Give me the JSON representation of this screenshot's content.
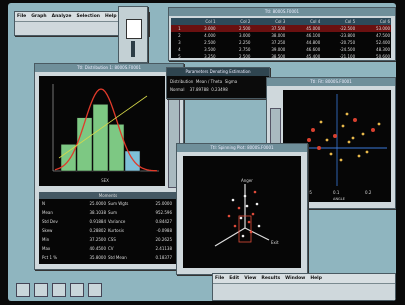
{
  "app": {
    "main_menu": [
      "File",
      "Graph",
      "Analyze",
      "Selection",
      "Help"
    ],
    "bottom_menu": [
      "File",
      "Edit",
      "View",
      "Results",
      "Window",
      "Help"
    ]
  },
  "windows": {
    "table_title": "Ttl: 8000S.F0001",
    "histogram_title": "Ttl: Distribution 1: 8000S.F0001",
    "params_title": "Parameters Denoting Estimation",
    "params_row1": [
      "Distribution",
      "Mean / Theta",
      "Sigma"
    ],
    "params_row2": [
      "Normal",
      "37.89788",
      "0.23498"
    ],
    "scatter_title": "Ttl: Fit: 8000S.F0001",
    "spin_title": "Ttl: Spinning Plot: 8000S.F0001",
    "stats_title": "Moments",
    "scatter_labels": [
      "0.05",
      "0.1",
      "0.2"
    ],
    "scatter_xlabel": "ANGLE",
    "spin_labels": [
      "Anger",
      "Exit"
    ],
    "stats_left": [
      [
        "N",
        "25.0000"
      ],
      [
        "Mean",
        "38.1038"
      ],
      [
        "Std Dev",
        "0.91884"
      ],
      [
        "Skew",
        "0.28802"
      ],
      [
        "Min",
        "37.2500"
      ],
      [
        "Max",
        "40.4500"
      ],
      [
        "Pct 1 %",
        "35.8000"
      ]
    ],
    "stats_right": [
      [
        "Sum Wgts",
        "25.0000"
      ],
      [
        "Sum",
        "952.596"
      ],
      [
        "Variance",
        "0.84427"
      ],
      [
        "Kurtosis",
        "-0.0988"
      ],
      [
        "CSS",
        "20.2625"
      ],
      [
        "CV",
        "2.41138"
      ],
      [
        "Std Mean",
        "0.18377"
      ]
    ]
  },
  "table": {
    "headers": [
      "",
      "Col 1",
      "Col 2",
      "Col 3",
      "Col 4",
      "Col 5",
      "Col 6"
    ],
    "rows": [
      [
        "1",
        "3.000",
        "2.500",
        "37.500",
        "45.000",
        "-22.500",
        "53.000"
      ],
      [
        "2",
        "4.000",
        "3.000",
        "38.000",
        "46.100",
        "-23.800",
        "47.500"
      ],
      [
        "3",
        "2.500",
        "2.250",
        "37.250",
        "44.800",
        "-20.750",
        "52.400"
      ],
      [
        "4",
        "3.500",
        "2.750",
        "39.000",
        "46.600",
        "-24.500",
        "48.300"
      ],
      [
        "5",
        "3.250",
        "2.500",
        "38.500",
        "45.400",
        "-21.100",
        "50.600"
      ]
    ]
  },
  "chart_data": {
    "type": "bar",
    "categories": [
      "1",
      "2",
      "3",
      "4",
      "5"
    ],
    "values": [
      4,
      8,
      10,
      7,
      3
    ],
    "ylim": [
      0,
      12
    ],
    "xlabel": "SEX",
    "curve": "normal"
  },
  "colors": {
    "desktop": "#8fb5bf",
    "bars": "#7dc883",
    "bar_last": "#7fc0d8",
    "curve": "#e03a2a",
    "points": "#e8b84a"
  }
}
